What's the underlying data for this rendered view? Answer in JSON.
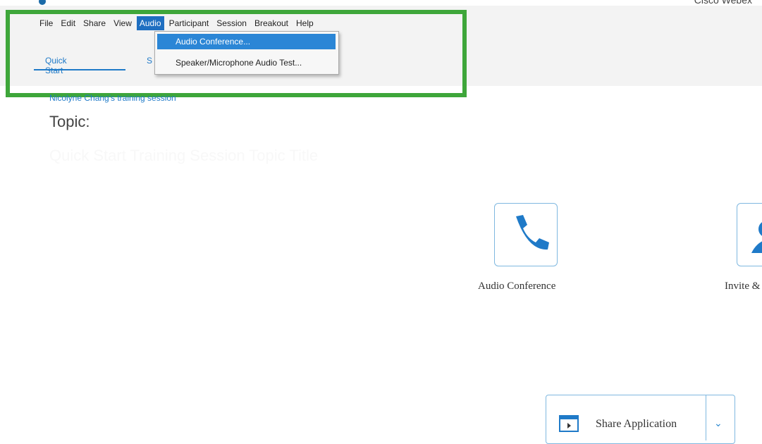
{
  "app": {
    "title": "Cisco Webex"
  },
  "menubar": {
    "items": [
      {
        "label": "File"
      },
      {
        "label": "Edit"
      },
      {
        "label": "Share"
      },
      {
        "label": "View"
      },
      {
        "label": "Audio"
      },
      {
        "label": "Participant"
      },
      {
        "label": "Session"
      },
      {
        "label": "Breakout"
      },
      {
        "label": "Help"
      }
    ]
  },
  "audio_menu": {
    "items": [
      {
        "label": "Audio Conference..."
      },
      {
        "label": "Speaker/Microphone Audio Test..."
      }
    ]
  },
  "tabs": {
    "quick_start": "Quick Start",
    "other": "S"
  },
  "main": {
    "host_line": "Nicolyne Chang's training session",
    "topic_label": "Topic:",
    "topic_value": "Quick Start Training Session Topic Title",
    "tiles": [
      {
        "label": "Audio Conference",
        "icon": "phone-icon"
      },
      {
        "label": "Invite &",
        "icon": "person-icon"
      }
    ],
    "share": {
      "label": "Share Application",
      "icon": "share-application-icon",
      "chevron": "chevron-down-icon"
    }
  },
  "colors": {
    "accent": "#1f7ac8",
    "highlight_box": "#3ea63a",
    "menu_active": "#1f6fc1"
  }
}
